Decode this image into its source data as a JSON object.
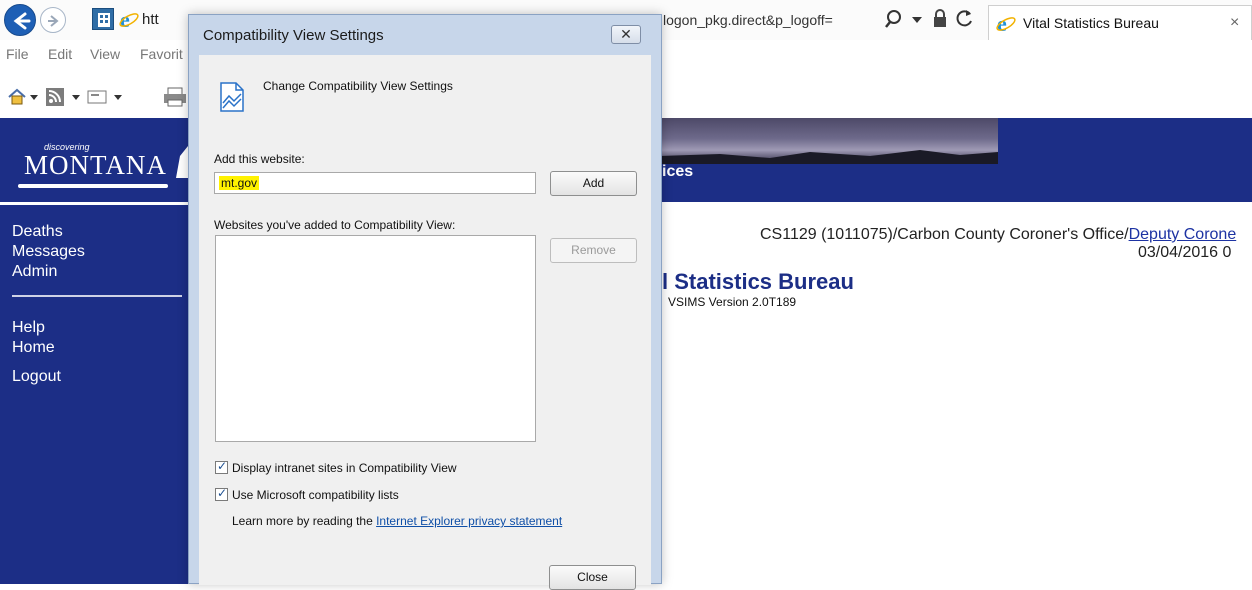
{
  "browser": {
    "url_left": "htt",
    "url_right": "logon_pkg.direct&p_logoff=",
    "tab_title": "Vital Statistics Bureau",
    "tab_close": "×",
    "menu": [
      "File",
      "Edit",
      "View",
      "Favorit"
    ]
  },
  "page": {
    "logo_small": "discovering",
    "logo_main": "MONTANA",
    "header_text": "ices",
    "nav": [
      "Deaths",
      "Messages",
      "Admin",
      "Help",
      "Home",
      "Logout"
    ],
    "user_prefix": "CS1129 (1011075)/Carbon County Coroner's Office/",
    "user_role": "Deputy Corone",
    "date": "03/04/2016 0",
    "title": "l Statistics Bureau",
    "version": "VSIMS Version 2.0T189"
  },
  "dialog": {
    "title": "Compatibility View Settings",
    "close_glyph": "✕",
    "heading": "Change Compatibility View Settings",
    "add_label": "Add this website:",
    "add_value": "mt.gov",
    "add_button": "Add",
    "list_label": "Websites you've added to Compatibility View:",
    "remove_button": "Remove",
    "check_intranet": "Display intranet sites in Compatibility View",
    "check_ms_lists": "Use Microsoft compatibility lists",
    "learn_prefix": "Learn more by reading the ",
    "learn_link": "Internet Explorer privacy statement",
    "close_button": "Close"
  }
}
